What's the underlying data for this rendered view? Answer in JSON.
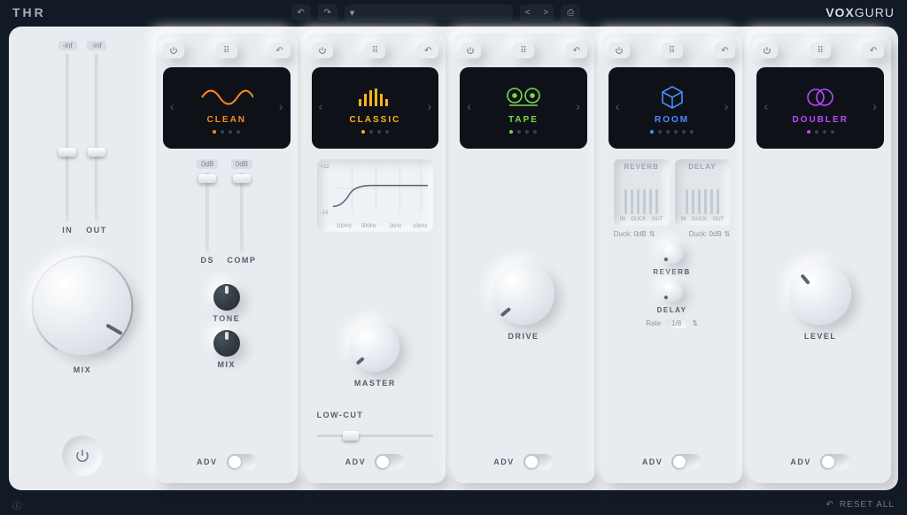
{
  "app": {
    "logo": "THR",
    "brand_bold": "VOX",
    "brand_light": "GURU"
  },
  "topbar": {
    "undo": "↶",
    "redo": "↷",
    "preset_caret": "▾",
    "nav_prev": "<",
    "nav_next": ">",
    "save": "⎙"
  },
  "io": {
    "in_badge": "-inf",
    "out_badge": "-inf",
    "in_label": "IN",
    "out_label": "OUT",
    "mix_label": "MIX"
  },
  "modules": [
    {
      "id": "clean",
      "title": "CLEAN",
      "color": "#ff8a1f",
      "dots": 4,
      "active_dot": 0,
      "sliders": [
        {
          "badge": "0dB",
          "label": "DS"
        },
        {
          "badge": "0dB",
          "label": "COMP"
        }
      ],
      "knobs": [
        {
          "label": "TONE"
        },
        {
          "label": "MIX"
        }
      ],
      "adv": "ADV"
    },
    {
      "id": "classic",
      "title": "CLASSIC",
      "color": "#ffb21f",
      "dots": 4,
      "active_dot": 0,
      "eq": {
        "y_top": "+12",
        "y_bot": "-14",
        "x": [
          "100Hz",
          "500Hz",
          "2kHz",
          "10kHz"
        ]
      },
      "master": "MASTER",
      "lowcut": "LOW-CUT",
      "adv": "ADV"
    },
    {
      "id": "tape",
      "title": "TAPE",
      "color": "#7bd84a",
      "dots": 4,
      "active_dot": 0,
      "drive": "DRIVE",
      "adv": "ADV"
    },
    {
      "id": "room",
      "title": "ROOM",
      "color": "#4a8dff",
      "dots": 6,
      "active_dot": 0,
      "fx": [
        {
          "name": "REVERB",
          "cols": [
            "IN",
            "DUCK",
            "OUT"
          ],
          "duck": "Duck: 0dB"
        },
        {
          "name": "DELAY",
          "cols": [
            "IN",
            "DUCK",
            "OUT"
          ],
          "duck": "Duck: 0dB"
        }
      ],
      "reverb_knob": "REVERB",
      "delay_knob": "DELAY",
      "rate_label": "Rate",
      "rate_value": "1/8",
      "adv": "ADV"
    },
    {
      "id": "doubler",
      "title": "DOUBLER",
      "color": "#b84aff",
      "dots": 4,
      "active_dot": 0,
      "level": "LEVEL",
      "adv": "ADV"
    }
  ],
  "footer": {
    "info": "ⓘ",
    "reset": "RESET ALL",
    "reset_icon": "↶"
  }
}
